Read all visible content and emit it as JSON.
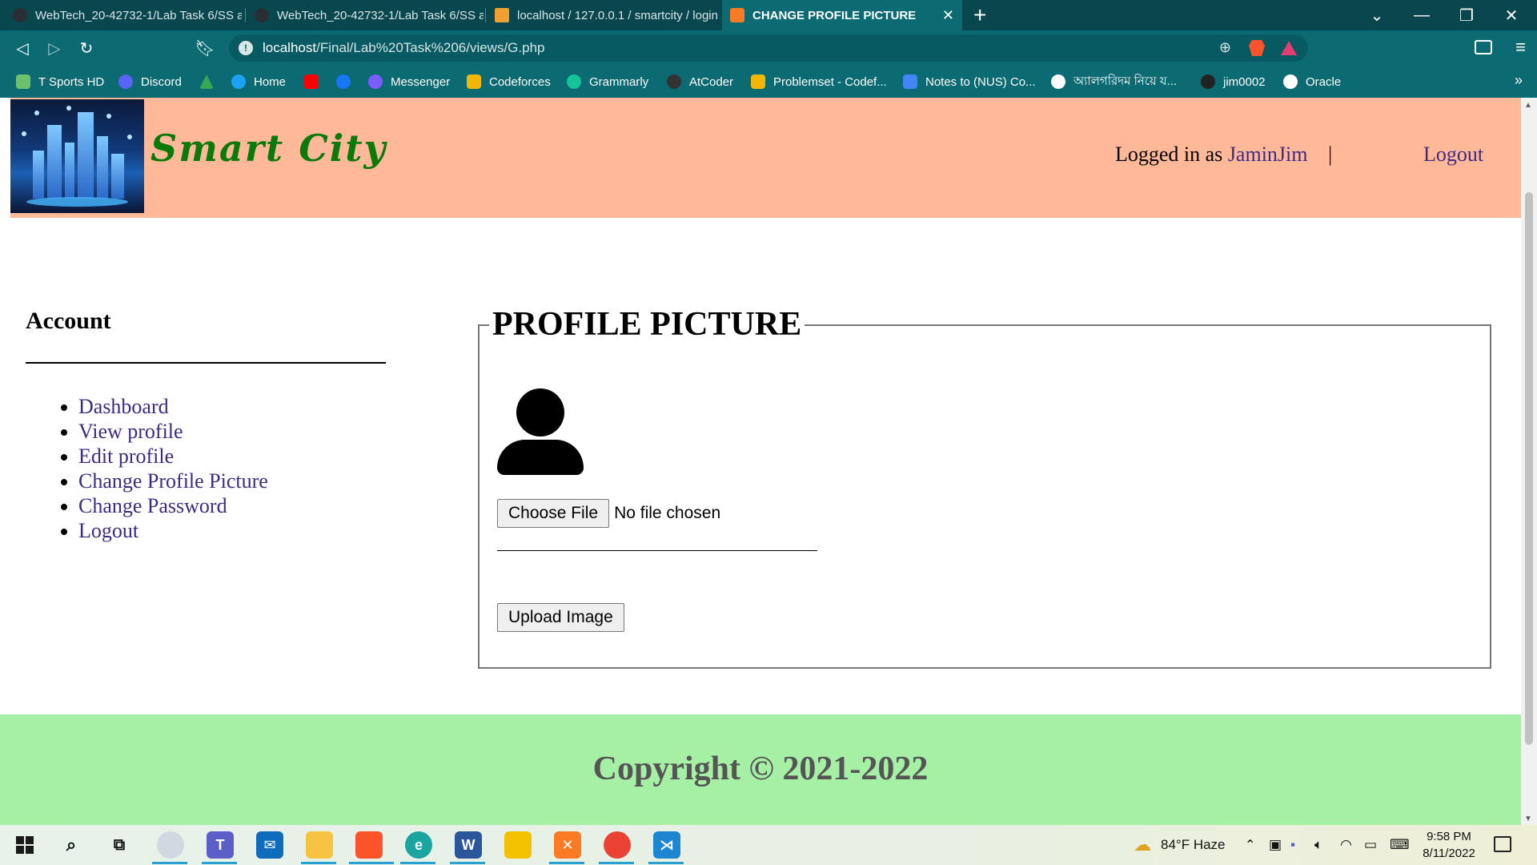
{
  "browser": {
    "tabs": [
      {
        "label": "WebTech_20-42732-1/Lab Task 6/SS at"
      },
      {
        "label": "WebTech_20-42732-1/Lab Task 6/SS at"
      },
      {
        "label": "localhost / 127.0.0.1 / smartcity / login"
      },
      {
        "label": "CHANGE PROFILE PICTURE",
        "active": true
      }
    ],
    "new_tab": "+",
    "url_host": "localhost",
    "url_path": "/Final/Lab%20Task%206/views/G.php",
    "bookmarks": [
      {
        "label": "T Sports HD",
        "color": "#6cc26c"
      },
      {
        "label": "Discord",
        "color": "#5865f2"
      },
      {
        "label": "",
        "color": "#34a853"
      },
      {
        "label": "Home",
        "color": "#1da1f2"
      },
      {
        "label": "",
        "color": "#ff0000"
      },
      {
        "label": "",
        "color": "#1877f2"
      },
      {
        "label": "Messenger",
        "color": "#7b5cff"
      },
      {
        "label": "Codeforces",
        "color": "#f2b705"
      },
      {
        "label": "Grammarly",
        "color": "#15c39a"
      },
      {
        "label": "AtCoder",
        "color": "#333333"
      },
      {
        "label": "Problemset - Codef...",
        "color": "#f2b705"
      },
      {
        "label": "Notes to (NUS) Co...",
        "color": "#4285f4"
      },
      {
        "label": "অ্যালগরিদম নিয়ে য...",
        "color": "#ffffff"
      },
      {
        "label": "jim0002",
        "color": "#222222"
      },
      {
        "label": "Oracle",
        "color": "#ffffff"
      }
    ],
    "bookmarks_more": "»"
  },
  "header": {
    "site_title": "Smart City",
    "logged_in_prefix": "Logged in as ",
    "username": "JaminJim",
    "separator": "|",
    "logout": "Logout"
  },
  "sidebar": {
    "title": "Account",
    "items": [
      {
        "label": "Dashboard"
      },
      {
        "label": "View profile"
      },
      {
        "label": "Edit profile"
      },
      {
        "label": "Change Profile Picture"
      },
      {
        "label": "Change Password"
      },
      {
        "label": "Logout"
      }
    ]
  },
  "main": {
    "legend": "PROFILE PICTURE",
    "choose_file": "Choose File",
    "no_file": "No file chosen",
    "upload": "Upload Image"
  },
  "footer": {
    "copyright": "Copyright © 2021-2022"
  },
  "taskbar": {
    "weather": "84°F  Haze",
    "time": "9:58 PM",
    "date": "8/11/2022"
  },
  "colors": {
    "header_bg": "#ffb999",
    "footer_bg": "#a6f0a6",
    "link": "#3e2a85",
    "title_green": "#0a7a0a"
  }
}
